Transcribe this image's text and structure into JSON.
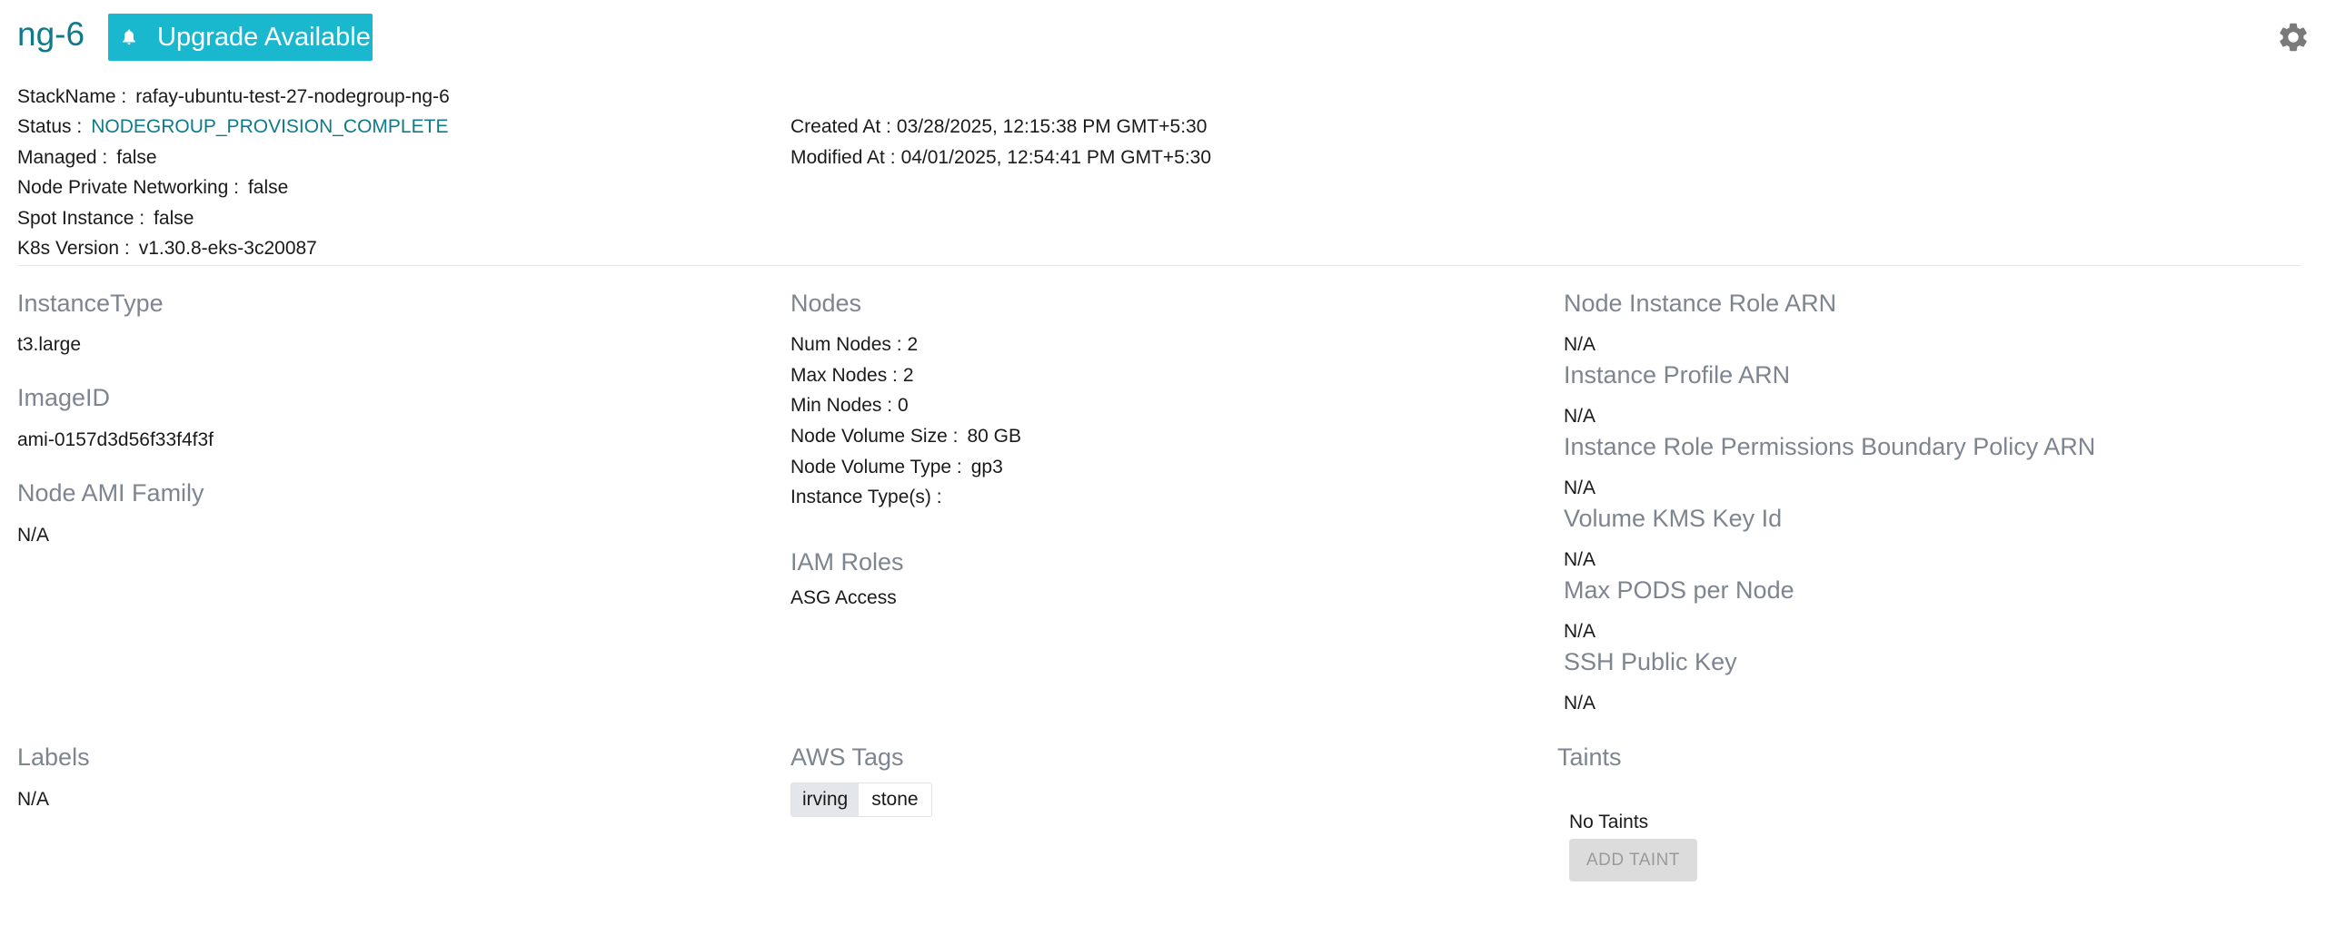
{
  "header": {
    "title": "ng-6",
    "upgrade_label": "Upgrade Available"
  },
  "overview": {
    "stack_name": {
      "label": "StackName :",
      "value": "rafay-ubuntu-test-27-nodegroup-ng-6"
    },
    "status": {
      "label": "Status :",
      "value": "NODEGROUP_PROVISION_COMPLETE"
    },
    "managed": {
      "label": "Managed :",
      "value": "false"
    },
    "private_networking": {
      "label": "Node Private Networking :",
      "value": "false"
    },
    "spot_instance": {
      "label": "Spot Instance :",
      "value": "false"
    },
    "k8s_version": {
      "label": "K8s Version :",
      "value": "v1.30.8-eks-3c20087"
    },
    "created_at": {
      "label": "Created At :",
      "value": "03/28/2025, 12:15:38 PM GMT+5:30"
    },
    "modified_at": {
      "label": "Modified At :",
      "value": "04/01/2025, 12:54:41 PM GMT+5:30"
    }
  },
  "left_column": {
    "instance_type": {
      "title": "InstanceType",
      "value": "t3.large"
    },
    "image_id": {
      "title": "ImageID",
      "value": "ami-0157d3d56f33f4f3f"
    },
    "ami_family": {
      "title": "Node AMI Family",
      "value": "N/A"
    }
  },
  "nodes": {
    "title": "Nodes",
    "num_nodes": {
      "label": "Num Nodes :",
      "value": "2"
    },
    "max_nodes": {
      "label": "Max Nodes :",
      "value": "2"
    },
    "min_nodes": {
      "label": "Min Nodes :",
      "value": "0"
    },
    "volume_size": {
      "label": "Node Volume Size :",
      "value": "80 GB"
    },
    "volume_type": {
      "label": "Node Volume Type :",
      "value": "gp3"
    },
    "instance_types": {
      "label": "Instance Type(s) :",
      "value": ""
    }
  },
  "iam": {
    "title": "IAM Roles",
    "value": "ASG Access"
  },
  "right_column": {
    "role_arn": {
      "title": "Node Instance Role ARN",
      "value": "N/A"
    },
    "profile_arn": {
      "title": "Instance Profile ARN",
      "value": "N/A"
    },
    "boundary_arn": {
      "title": "Instance Role Permissions Boundary Policy ARN",
      "value": "N/A"
    },
    "kms_key": {
      "title": "Volume KMS Key Id",
      "value": "N/A"
    },
    "max_pods": {
      "title": "Max PODS per Node",
      "value": "N/A"
    },
    "ssh_key": {
      "title": "SSH Public Key",
      "value": "N/A"
    }
  },
  "labels": {
    "title": "Labels",
    "value": "N/A"
  },
  "aws_tags": {
    "title": "AWS Tags",
    "tags": [
      {
        "key": "irving",
        "value": "stone"
      }
    ]
  },
  "taints": {
    "title": "Taints",
    "empty_text": "No Taints",
    "add_label": "ADD TAINT"
  },
  "colors": {
    "accent": "#1ab8cf",
    "title": "#0e7a8a",
    "section": "#7d8590"
  }
}
